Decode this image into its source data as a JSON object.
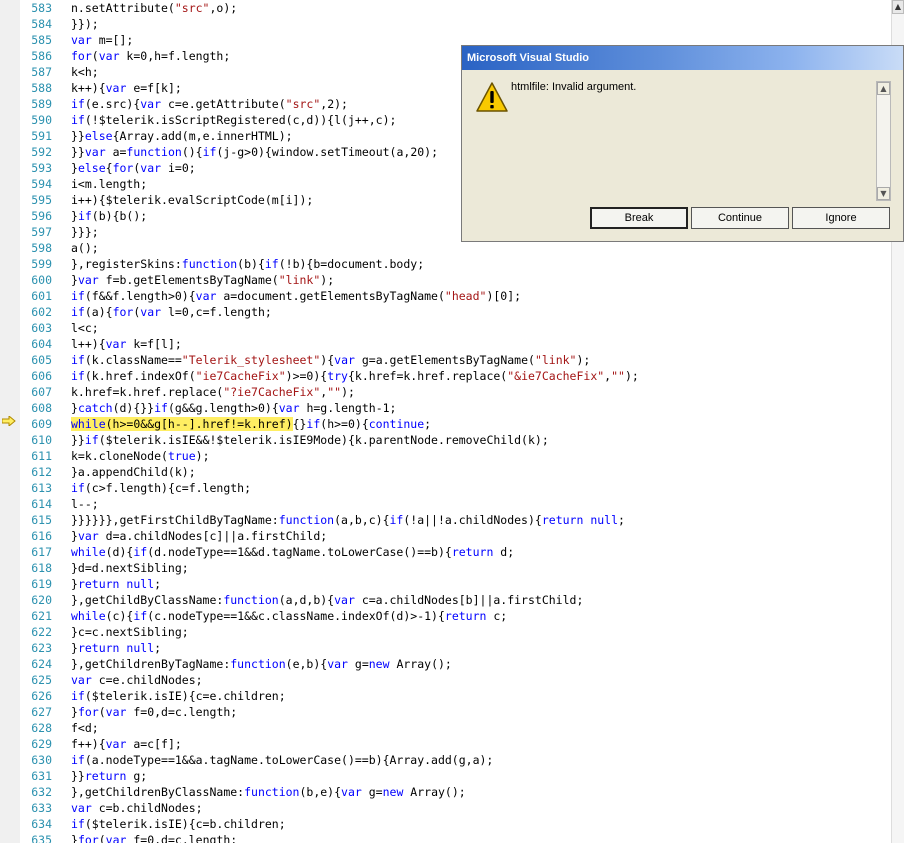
{
  "editor": {
    "current_line_index": 26,
    "lines": [
      {
        "n": "583",
        "code": "n.setAttribute(\"src\",o);"
      },
      {
        "n": "584",
        "code": "}});"
      },
      {
        "n": "585",
        "code": "var m=[];"
      },
      {
        "n": "586",
        "code": "for(var k=0,h=f.length;"
      },
      {
        "n": "587",
        "code": "k<h;"
      },
      {
        "n": "588",
        "code": "k++){var e=f[k];"
      },
      {
        "n": "589",
        "code": "if(e.src){var c=e.getAttribute(\"src\",2);"
      },
      {
        "n": "590",
        "code": "if(!$telerik.isScriptRegistered(c,d)){l(j++,c);"
      },
      {
        "n": "591",
        "code": "}}else{Array.add(m,e.innerHTML);"
      },
      {
        "n": "592",
        "code": "}}var a=function(){if(j-g>0){window.setTimeout(a,20);"
      },
      {
        "n": "593",
        "code": "}else{for(var i=0;"
      },
      {
        "n": "594",
        "code": "i<m.length;"
      },
      {
        "n": "595",
        "code": "i++){$telerik.evalScriptCode(m[i]);"
      },
      {
        "n": "596",
        "code": "}if(b){b();"
      },
      {
        "n": "597",
        "code": "}}};"
      },
      {
        "n": "598",
        "code": "a();"
      },
      {
        "n": "599",
        "code": "},registerSkins:function(b){if(!b){b=document.body;"
      },
      {
        "n": "600",
        "code": "}var f=b.getElementsByTagName(\"link\");"
      },
      {
        "n": "601",
        "code": "if(f&&f.length>0){var a=document.getElementsByTagName(\"head\")[0];"
      },
      {
        "n": "602",
        "code": "if(a){for(var l=0,c=f.length;"
      },
      {
        "n": "603",
        "code": "l<c;"
      },
      {
        "n": "604",
        "code": "l++){var k=f[l];"
      },
      {
        "n": "605",
        "code": "if(k.className==\"Telerik_stylesheet\"){var g=a.getElementsByTagName(\"link\");"
      },
      {
        "n": "606",
        "code": "if(k.href.indexOf(\"ie7CacheFix\")>=0){try{k.href=k.href.replace(\"&ie7CacheFix\",\"\");"
      },
      {
        "n": "607",
        "code": "k.href=k.href.replace(\"?ie7CacheFix\",\"\");"
      },
      {
        "n": "608",
        "code": "}catch(d){}}if(g&&g.length>0){var h=g.length-1;"
      },
      {
        "n": "609",
        "code": "while(h>=0&&g[h--].href!=k.href){}if(h>=0){continue;",
        "hl": "while(h>=0&&g[h--].href!=k.href)",
        "rest": "{}if(h>=0){continue;"
      },
      {
        "n": "610",
        "code": "}}if($telerik.isIE&&!$telerik.isIE9Mode){k.parentNode.removeChild(k);"
      },
      {
        "n": "611",
        "code": "k=k.cloneNode(true);"
      },
      {
        "n": "612",
        "code": "}a.appendChild(k);"
      },
      {
        "n": "613",
        "code": "if(c>f.length){c=f.length;"
      },
      {
        "n": "614",
        "code": "l--;"
      },
      {
        "n": "615",
        "code": "}}}}}},getFirstChildByTagName:function(a,b,c){if(!a||!a.childNodes){return null;"
      },
      {
        "n": "616",
        "code": "}var d=a.childNodes[c]||a.firstChild;"
      },
      {
        "n": "617",
        "code": "while(d){if(d.nodeType==1&&d.tagName.toLowerCase()==b){return d;"
      },
      {
        "n": "618",
        "code": "}d=d.nextSibling;"
      },
      {
        "n": "619",
        "code": "}return null;"
      },
      {
        "n": "620",
        "code": "},getChildByClassName:function(a,d,b){var c=a.childNodes[b]||a.firstChild;"
      },
      {
        "n": "621",
        "code": "while(c){if(c.nodeType==1&&c.className.indexOf(d)>-1){return c;"
      },
      {
        "n": "622",
        "code": "}c=c.nextSibling;"
      },
      {
        "n": "623",
        "code": "}return null;"
      },
      {
        "n": "624",
        "code": "},getChildrenByTagName:function(e,b){var g=new Array();"
      },
      {
        "n": "625",
        "code": "var c=e.childNodes;"
      },
      {
        "n": "626",
        "code": "if($telerik.isIE){c=e.children;"
      },
      {
        "n": "627",
        "code": "}for(var f=0,d=c.length;"
      },
      {
        "n": "628",
        "code": "f<d;"
      },
      {
        "n": "629",
        "code": "f++){var a=c[f];"
      },
      {
        "n": "630",
        "code": "if(a.nodeType==1&&a.tagName.toLowerCase()==b){Array.add(g,a);"
      },
      {
        "n": "631",
        "code": "}}return g;"
      },
      {
        "n": "632",
        "code": "},getChildrenByClassName:function(b,e){var g=new Array();"
      },
      {
        "n": "633",
        "code": "var c=b.childNodes;"
      },
      {
        "n": "634",
        "code": "if($telerik.isIE){c=b.children;"
      },
      {
        "n": "635",
        "code": "}for(var f=0,d=c.length;"
      }
    ]
  },
  "dialog": {
    "title": "Microsoft Visual Studio",
    "message": "htmlfile: Invalid argument.",
    "icon": "warning-icon",
    "buttons": {
      "break": "Break",
      "continue": "Continue",
      "ignore": "Ignore"
    }
  },
  "colors": {
    "line_number": "#2b91af",
    "keyword": "#0000ff",
    "string": "#a31515",
    "current_statement": "#ffee62",
    "title_bar": "#2a63c4"
  }
}
